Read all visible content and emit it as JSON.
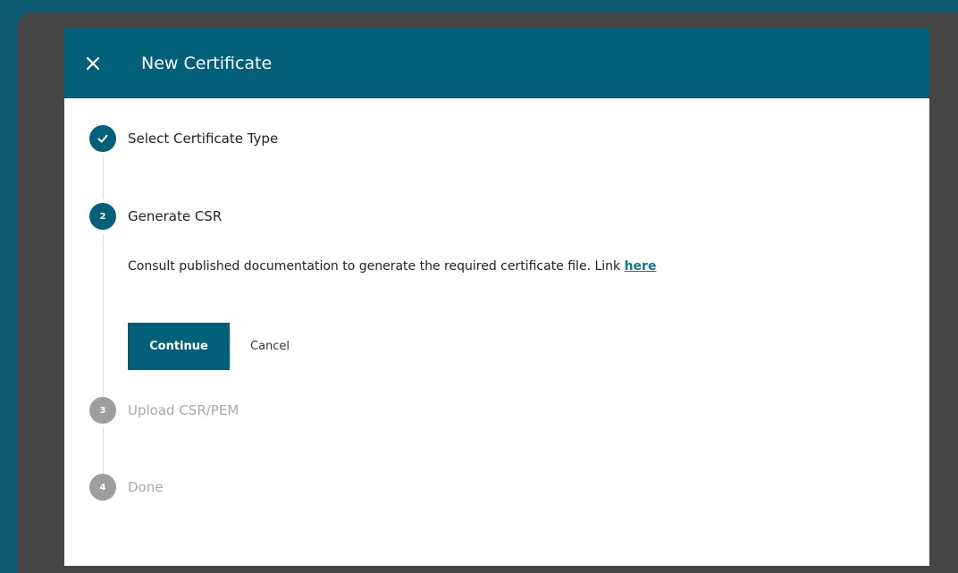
{
  "dialog": {
    "title": "New Certificate",
    "close_icon": "close-icon"
  },
  "steps": [
    {
      "number": "1",
      "label": "Select Certificate Type",
      "state": "completed",
      "icon": "check-icon"
    },
    {
      "number": "2",
      "label": "Generate CSR",
      "state": "active"
    },
    {
      "number": "3",
      "label": "Upload CSR/PEM",
      "state": "inactive"
    },
    {
      "number": "4",
      "label": "Done",
      "state": "inactive"
    }
  ],
  "generate_csr": {
    "description": "Consult published documentation to generate the required certificate file. Link ",
    "link_text": "here",
    "continue_label": "Continue",
    "cancel_label": "Cancel"
  },
  "colors": {
    "page_background": "#0d5a73",
    "header": "#02607a",
    "accent": "#02607a",
    "link": "#0b7a8e",
    "inactive_step": "#9e9e9e"
  }
}
